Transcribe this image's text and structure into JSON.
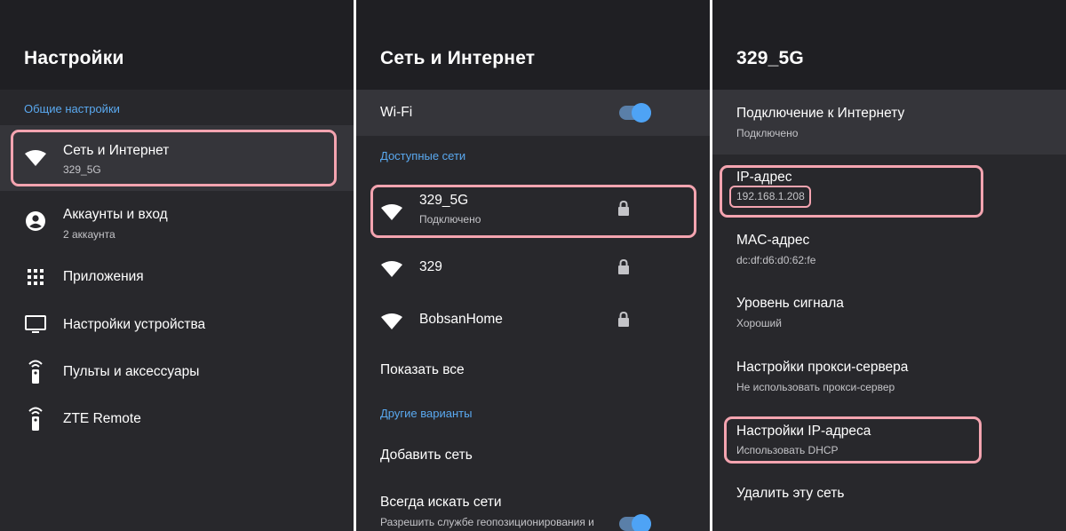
{
  "settings_panel": {
    "title": "Настройки",
    "section_general": "Общие настройки",
    "items": [
      {
        "label": "Сеть и Интернет",
        "sub": "329_5G",
        "icon": "wifi-icon"
      },
      {
        "label": "Аккаунты и вход",
        "sub": "2 аккаунта",
        "icon": "account-icon"
      },
      {
        "label": "Приложения",
        "icon": "apps-grid-icon"
      },
      {
        "label": "Настройки устройства",
        "icon": "tv-icon"
      },
      {
        "label": "Пульты и аксессуары",
        "icon": "remote-icon"
      },
      {
        "label": "ZTE Remote",
        "icon": "remote-icon"
      }
    ]
  },
  "network_panel": {
    "title": "Сеть и Интернет",
    "wifi_label": "Wi-Fi",
    "wifi_enabled": true,
    "section_available": "Доступные сети",
    "networks": [
      {
        "ssid": "329_5G",
        "status": "Подключено",
        "locked": true
      },
      {
        "ssid": "329",
        "status": "",
        "locked": true
      },
      {
        "ssid": "BobsanHome",
        "status": "",
        "locked": true
      }
    ],
    "show_all": "Показать все",
    "section_other": "Другие варианты",
    "add_network": "Добавить сеть",
    "always_scan_label": "Всегда искать сети",
    "always_scan_sub": "Разрешить службе геопозиционирования и",
    "always_scan_enabled": true
  },
  "details_panel": {
    "title": "329_5G",
    "items": [
      {
        "label": "Подключение к Интернету",
        "sub": "Подключено"
      },
      {
        "label": "IP-адрес",
        "sub": "192.168.1.208"
      },
      {
        "label": "MAC-адрес",
        "sub": "dc:df:d6:d0:62:fe"
      },
      {
        "label": "Уровень сигнала",
        "sub": "Хороший"
      },
      {
        "label": "Настройки прокси-сервера",
        "sub": "Не использовать прокси-сервер"
      },
      {
        "label": "Настройки IP-адреса",
        "sub": "Использовать DHCP"
      },
      {
        "label": "Удалить эту сеть",
        "sub": ""
      }
    ]
  },
  "colors": {
    "panel_bg": "#28282c",
    "header_bg": "#1f1f23",
    "accent": "#5aa9f0",
    "highlight": "#f4a4b0"
  }
}
